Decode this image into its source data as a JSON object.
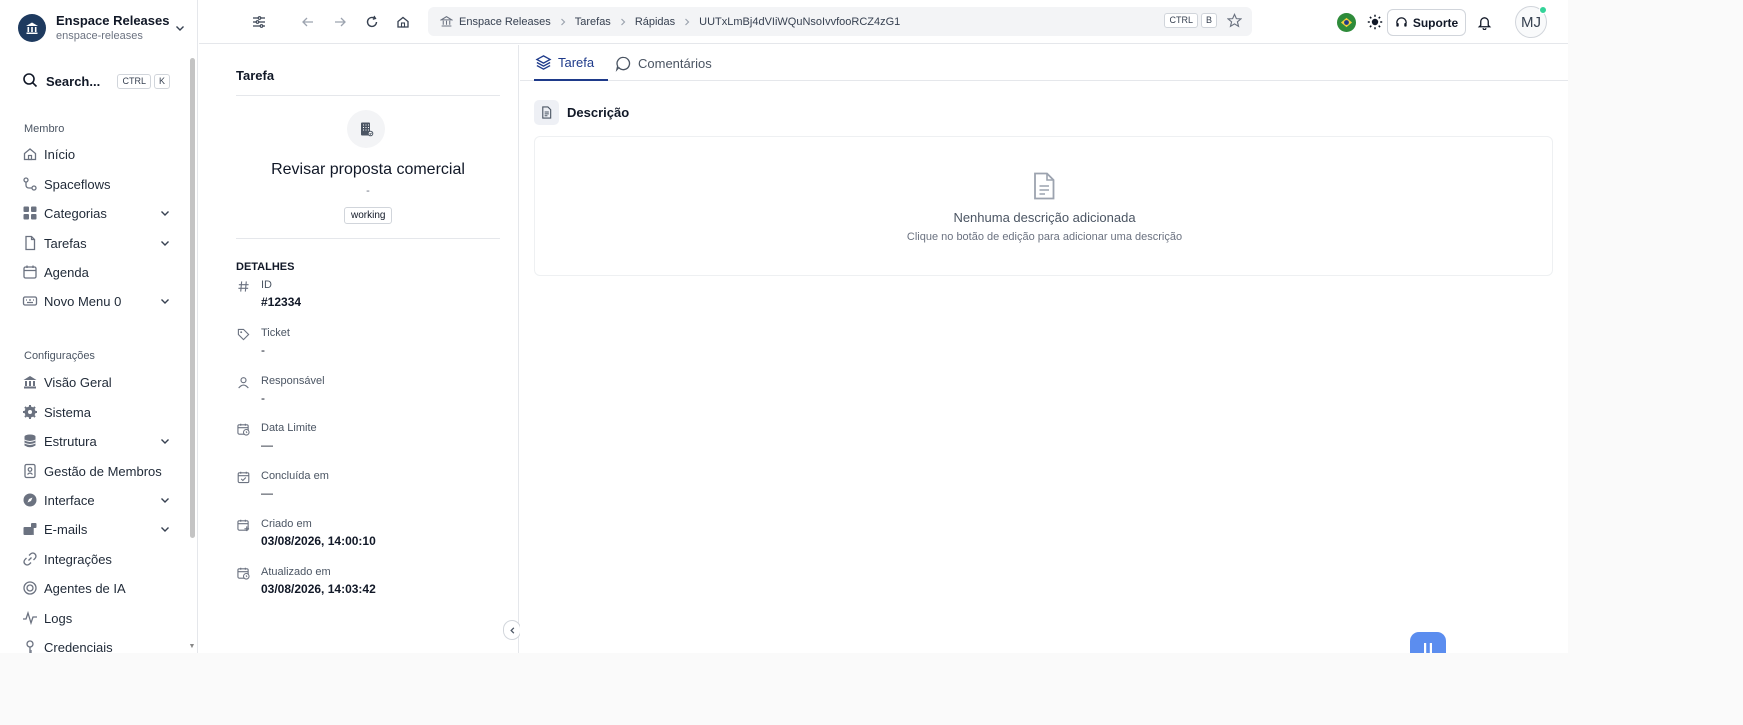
{
  "workspace": {
    "name": "Enspace Releases",
    "slug": "enspace-releases"
  },
  "search": {
    "label": "Search...",
    "shortcut": [
      "CTRL",
      "K"
    ]
  },
  "sidebar": {
    "member_section": "Membro",
    "member_items": [
      {
        "label": "Início",
        "icon": "home-icon",
        "expandable": false
      },
      {
        "label": "Spaceflows",
        "icon": "flow-icon",
        "expandable": false
      },
      {
        "label": "Categorias",
        "icon": "grid-icon",
        "expandable": true
      },
      {
        "label": "Tarefas",
        "icon": "file-icon",
        "expandable": true
      },
      {
        "label": "Agenda",
        "icon": "calendar-icon",
        "expandable": false
      },
      {
        "label": "Novo Menu 0",
        "icon": "keyboard-icon",
        "expandable": true
      }
    ],
    "config_section": "Configurações",
    "config_items": [
      {
        "label": "Visão Geral",
        "icon": "bank-icon",
        "expandable": false
      },
      {
        "label": "Sistema",
        "icon": "gear-icon",
        "expandable": false
      },
      {
        "label": "Estrutura",
        "icon": "database-icon",
        "expandable": true
      },
      {
        "label": "Gestão de Membros",
        "icon": "id-badge-icon",
        "expandable": false
      },
      {
        "label": "Interface",
        "icon": "compass-icon",
        "expandable": true
      },
      {
        "label": "E-mails",
        "icon": "mail-icon",
        "expandable": true
      },
      {
        "label": "Integrações",
        "icon": "link-icon",
        "expandable": false
      },
      {
        "label": "Agentes de IA",
        "icon": "ai-icon",
        "expandable": false
      },
      {
        "label": "Logs",
        "icon": "activity-icon",
        "expandable": false
      },
      {
        "label": "Credenciais",
        "icon": "key-icon",
        "expandable": false
      }
    ]
  },
  "breadcrumb": {
    "items": [
      "Enspace Releases",
      "Tarefas",
      "Rápidas",
      "UUTxLmBj4dVIiWQuNsoIvvfooRCZ4zG1"
    ],
    "shortcut": [
      "CTRL",
      "B"
    ]
  },
  "header": {
    "support_label": "Suporte",
    "avatar_initials": "MJ"
  },
  "task_panel": {
    "title": "Tarefa",
    "task_name": "Revisar proposta comercial",
    "subtitle": "-",
    "status": "working",
    "details_heading": "DETALHES",
    "fields": [
      {
        "label": "ID",
        "value": "#12334",
        "icon": "hash-icon",
        "strong": true
      },
      {
        "label": "Ticket",
        "value": "-",
        "icon": "tag-icon",
        "strong": false
      },
      {
        "label": "Responsável",
        "value": "-",
        "icon": "user-icon",
        "strong": false
      },
      {
        "label": "Data Limite",
        "value": "—",
        "icon": "calendar-clock-icon",
        "strong": false
      },
      {
        "label": "Concluída em",
        "value": "—",
        "icon": "calendar-check-icon",
        "strong": false
      },
      {
        "label": "Criado em",
        "value": "03/08/2026, 14:00:10",
        "icon": "calendar-plus-icon",
        "strong": true
      },
      {
        "label": "Atualizado em",
        "value": "03/08/2026, 14:03:42",
        "icon": "calendar-clock-icon",
        "strong": true
      }
    ]
  },
  "main": {
    "tabs": [
      {
        "label": "Tarefa",
        "icon": "layers-icon",
        "active": true
      },
      {
        "label": "Comentários",
        "icon": "chat-icon",
        "active": false
      }
    ],
    "description": {
      "title": "Descrição",
      "empty_title": "Nenhuma descrição adicionada",
      "empty_subtitle": "Clique no botão de edição para adicionar uma descrição"
    }
  },
  "colors": {
    "accent": "#1e3a8a",
    "brand": "#1e3a5f",
    "online": "#34d399",
    "fab": "#5b8def"
  }
}
